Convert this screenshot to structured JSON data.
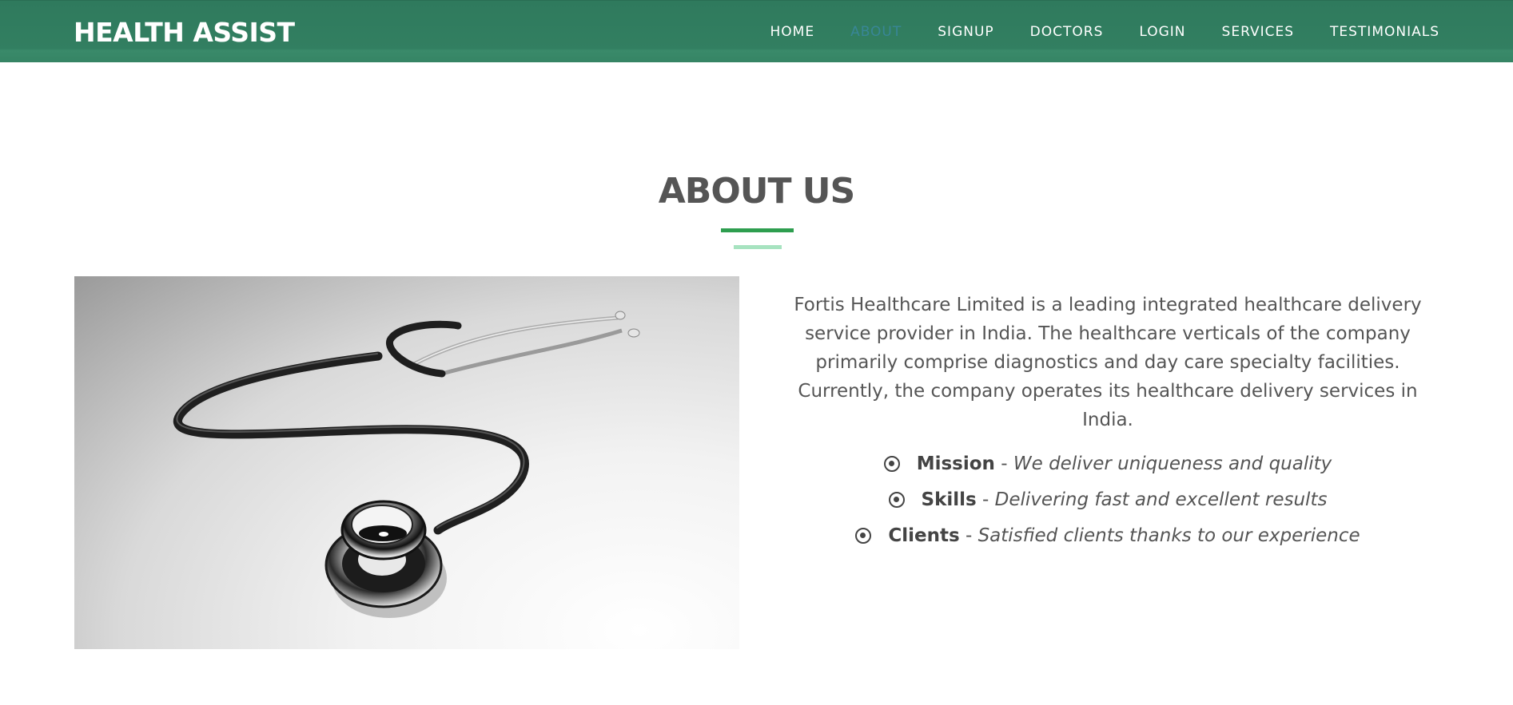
{
  "navbar": {
    "brand": "HEALTH ASSIST",
    "links": [
      "HOME",
      "ABOUT",
      "SIGNUP",
      "DOCTORS",
      "LOGIN",
      "SERVICES",
      "TESTIMONIALS"
    ],
    "active": "ABOUT"
  },
  "about": {
    "title": "ABOUT US",
    "paragraph": "Fortis Healthcare Limited is a leading integrated healthcare delivery service provider in India. The healthcare verticals of the company primarily comprise diagnostics and day care specialty facilities. Currently, the company operates its healthcare delivery services in India.",
    "features": [
      {
        "name": "Mission",
        "separator": " - ",
        "desc": "We deliver uniqueness and quality"
      },
      {
        "name": "Skills",
        "separator": " - ",
        "desc": "Delivering fast and excellent results"
      },
      {
        "name": "Clients",
        "separator": " - ",
        "desc": "Satisfied clients thanks to our experience"
      }
    ],
    "image_icon": "stethoscope-image"
  },
  "colors": {
    "navbar": "#327f61",
    "divider": "#2e9e4f",
    "divider_light": "#a7e3c0",
    "text": "#555555"
  }
}
